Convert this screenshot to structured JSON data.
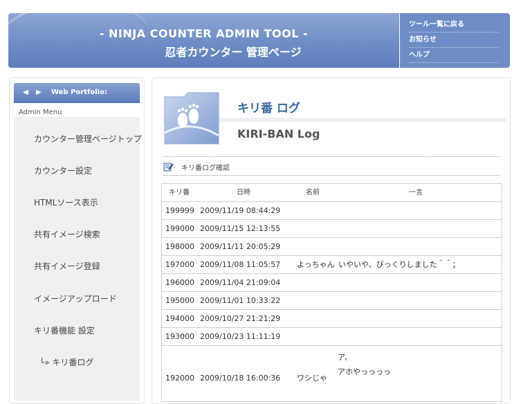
{
  "header": {
    "title_en": "- NINJA COUNTER ADMIN TOOL -",
    "title_jp": "忍者カウンター 管理ページ"
  },
  "topnav": {
    "items": [
      "ツール一覧に戻る",
      "お知らせ",
      "ヘルプ"
    ]
  },
  "sidebar": {
    "head_title": "Web Portfolio:",
    "admin_label": "Admin Menu",
    "items": [
      "カウンター管理ページトップ",
      "カウンター設定",
      "HTMLソース表示",
      "共有イメージ検索",
      "共有イメージ登録",
      "イメージアップロード",
      "キリ番機能 設定",
      "└» キリ番ログ"
    ]
  },
  "main": {
    "title": "キリ番 ログ",
    "subtitle": "KIRI-BAN Log",
    "section_label": "キリ番ログ確認"
  },
  "table": {
    "headers": [
      "キリ番",
      "日時",
      "名前",
      "一言"
    ],
    "rows": [
      {
        "kiri": "199999",
        "date": "2009/11/19 08:44:29",
        "name": "",
        "msg": ""
      },
      {
        "kiri": "199000",
        "date": "2009/11/15 12:13:55",
        "name": "",
        "msg": ""
      },
      {
        "kiri": "198000",
        "date": "2009/11/11 20:05:29",
        "name": "",
        "msg": ""
      },
      {
        "kiri": "197000",
        "date": "2009/11/08 11:05:57",
        "name": "よっちゃん",
        "msg": "いやいや、びっくりしました＾＾；"
      },
      {
        "kiri": "196000",
        "date": "2009/11/04 21:09:04",
        "name": "",
        "msg": ""
      },
      {
        "kiri": "195000",
        "date": "2009/11/01 10:33:22",
        "name": "",
        "msg": ""
      },
      {
        "kiri": "194000",
        "date": "2009/10/27 21:21:29",
        "name": "",
        "msg": ""
      },
      {
        "kiri": "193000",
        "date": "2009/10/23 11:11:19",
        "name": "",
        "msg": ""
      }
    ],
    "last_row": {
      "kiri": "192000",
      "date": "2009/10/18 16:00:36",
      "name": "ワシじゃ",
      "msg_line1": "ア、",
      "msg_line2": "アホやっっっっ"
    }
  },
  "colors": {
    "header_blue": "#6f8cc6",
    "title_blue": "#3c6aa4"
  }
}
